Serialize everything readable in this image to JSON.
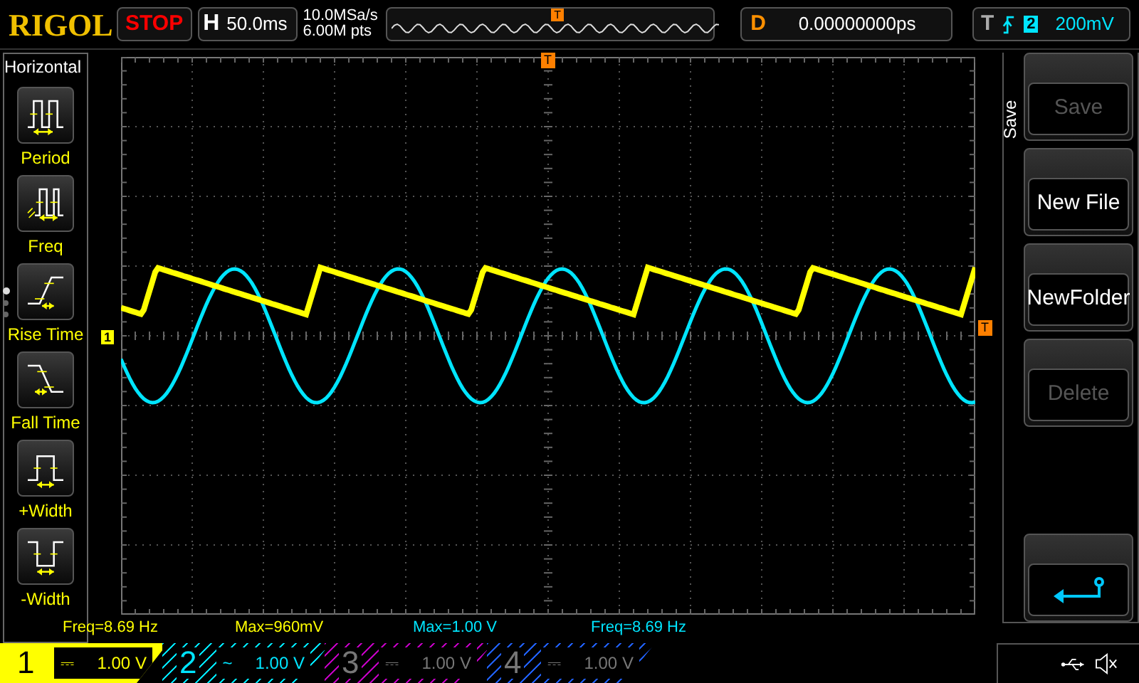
{
  "brand": "RIGOL",
  "run_state": "STOP",
  "timebase": {
    "label": "H",
    "value": "50.0ms"
  },
  "acquisition": {
    "sample_rate": "10.0MSa/s",
    "memory_depth": "6.00M pts",
    "trigger_marker": "T"
  },
  "delay": {
    "label": "D",
    "value": "0.00000000ps"
  },
  "trigger": {
    "label": "T",
    "source": "2",
    "level": "200mV"
  },
  "left_menu": {
    "title": "Horizontal",
    "page_dots": [
      {
        "selected": true
      },
      {
        "selected": false
      },
      {
        "selected": false
      }
    ],
    "items": [
      {
        "label": "Period",
        "kind": "period"
      },
      {
        "label": "Freq",
        "kind": "freq"
      },
      {
        "label": "Rise Time",
        "kind": "rise"
      },
      {
        "label": "Fall Time",
        "kind": "fall"
      },
      {
        "label": "+Width",
        "kind": "pwidth"
      },
      {
        "label": "-Width",
        "kind": "nwidth"
      }
    ]
  },
  "screen_markers": {
    "channel_marker": "1",
    "trigger_top": "T",
    "trigger_level": "T"
  },
  "right_menu": {
    "title": "Save",
    "buttons": [
      {
        "label": "Save",
        "disabled": true
      },
      {
        "label": "New File",
        "disabled": false
      },
      {
        "label": "NewFolder",
        "disabled": false
      },
      {
        "label": "Delete",
        "disabled": true
      }
    ]
  },
  "measurements": [
    {
      "text": "Freq=8.69 Hz",
      "color": "#ffff00"
    },
    {
      "text": "Max=960mV",
      "color": "#ffff00"
    },
    {
      "text": "Max=1.00 V",
      "color": "#00e5ff"
    },
    {
      "text": "Freq=8.69 Hz",
      "color": "#00e5ff"
    }
  ],
  "channels": [
    {
      "number": "1",
      "coupling": "⎓",
      "scale": "1.00 V",
      "on": true,
      "selected": true,
      "color": "#ffff00"
    },
    {
      "number": "2",
      "coupling": "~",
      "scale": "1.00 V",
      "on": true,
      "selected": false,
      "color": "#00e5ff"
    },
    {
      "number": "3",
      "coupling": "⎓",
      "scale": "1.00 V",
      "on": false,
      "selected": false,
      "color": "#c000c0"
    },
    {
      "number": "4",
      "coupling": "⎓",
      "scale": "1.00 V",
      "on": false,
      "selected": false,
      "color": "#2060ff"
    }
  ]
}
